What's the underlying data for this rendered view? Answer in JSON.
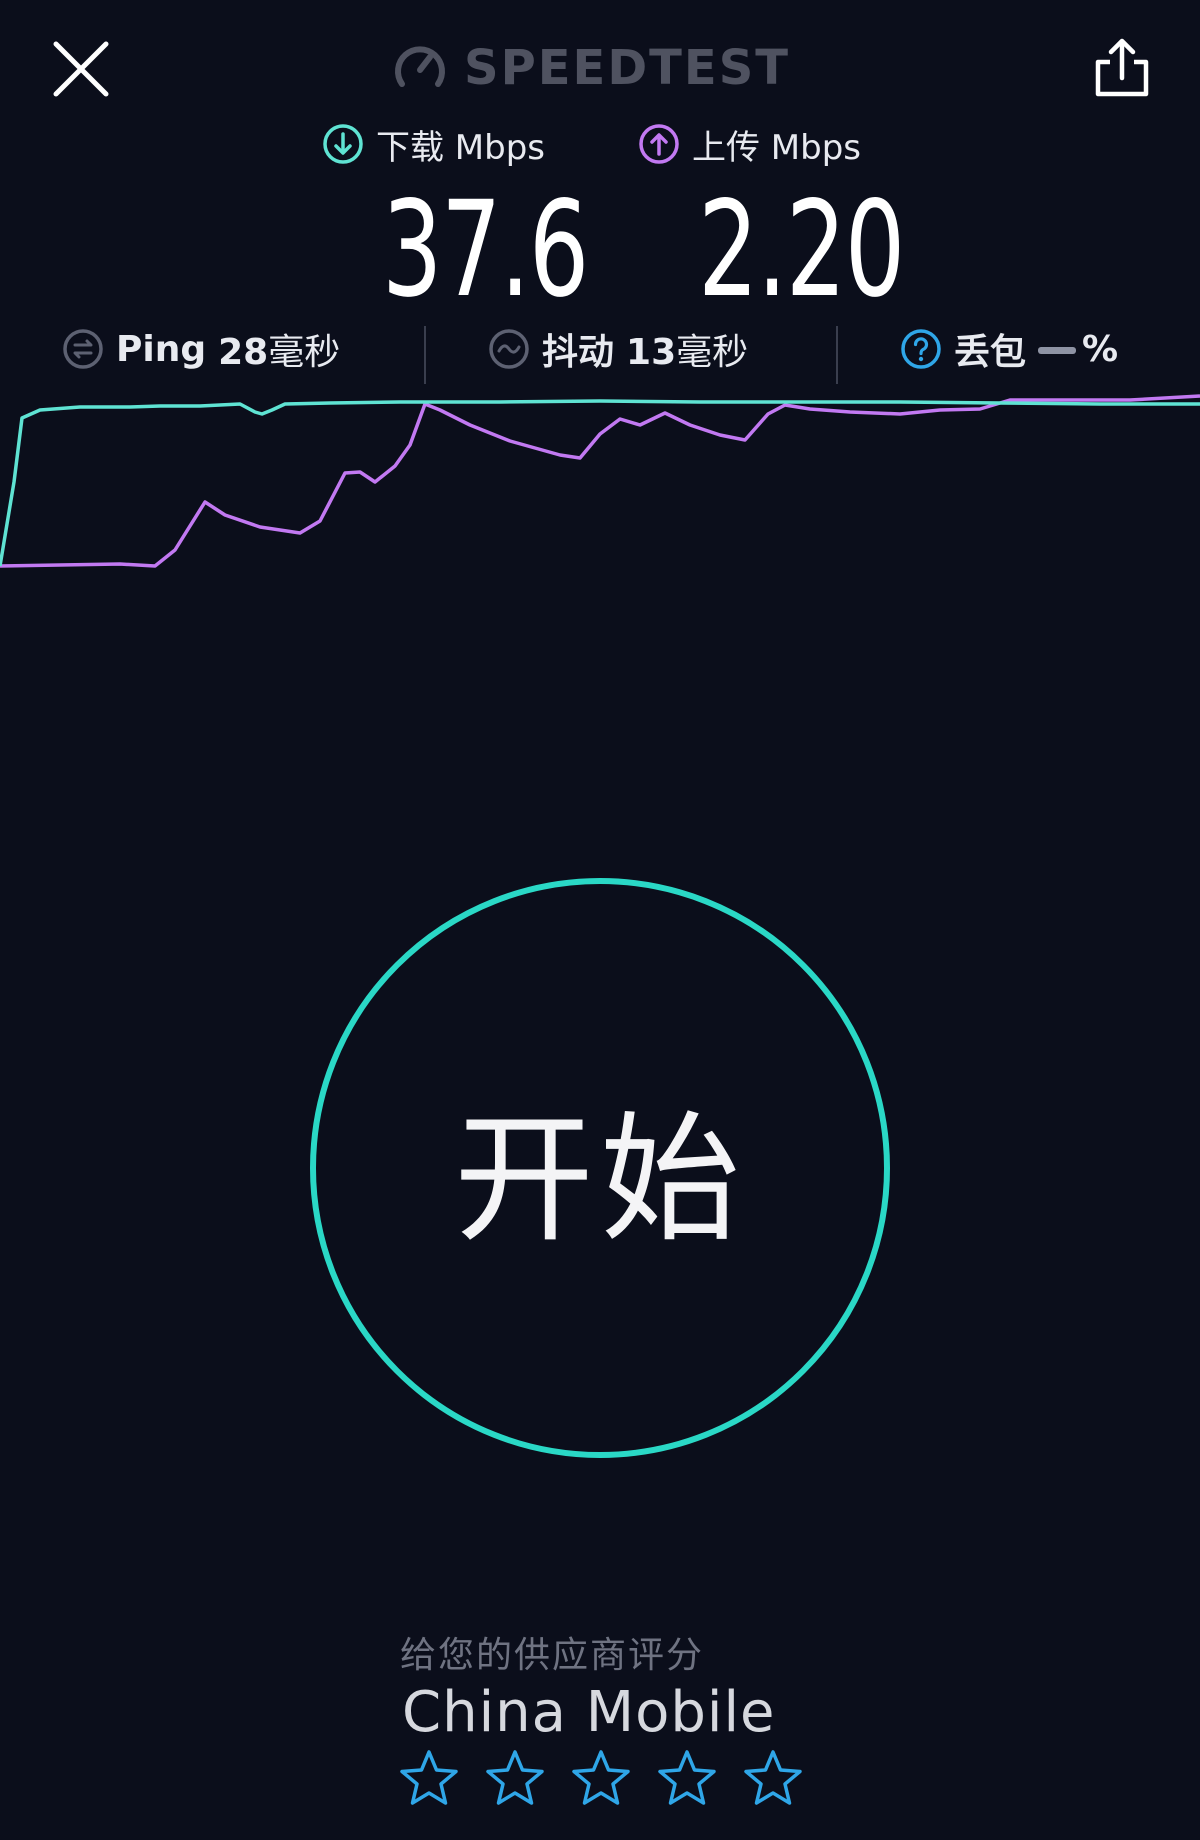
{
  "header": {
    "brand": "SPEEDTEST",
    "icons": {
      "close": "close-icon",
      "share": "share-icon",
      "logo": "speedometer-icon"
    }
  },
  "download": {
    "label": "下载 Mbps",
    "value": "37.6",
    "icon": "download-arrow-icon",
    "color": "#5fe3d3"
  },
  "upload": {
    "label": "上传 Mbps",
    "value": "2.20",
    "icon": "upload-arrow-icon",
    "color": "#c279f2"
  },
  "metrics": {
    "ping": {
      "label": "Ping",
      "value": "28",
      "unit": "毫秒",
      "icon": "ping-icon"
    },
    "jitter": {
      "label": "抖动",
      "value": "13",
      "unit": "毫秒",
      "icon": "jitter-icon"
    },
    "loss": {
      "label": "丢包",
      "value": "%",
      "icon": "help-icon",
      "icon_color": "#2fa6e8"
    }
  },
  "start_button": {
    "label": "开始",
    "color": "#2ad8c6"
  },
  "rating": {
    "prompt": "给您的供应商评分",
    "provider": "China Mobile",
    "stars": 5,
    "star_color": "#2fa6e8"
  }
}
